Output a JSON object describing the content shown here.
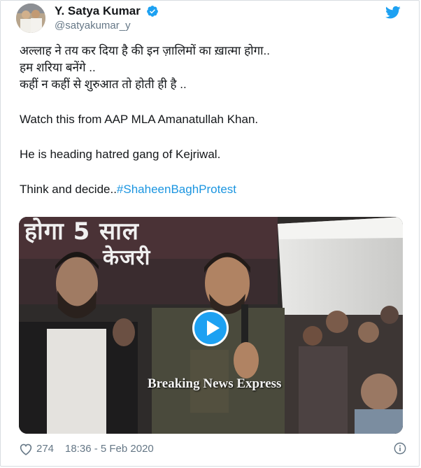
{
  "tweet": {
    "display_name": "Y. Satya Kumar",
    "handle": "@satyakumar_y",
    "verified": true,
    "text_lines": [
      "अल्लाह ने तय कर दिया है की इन ज़ालिमों का ख़ात्मा होगा..",
      "हम शरिया बनेंगे ..",
      "कहीं न कहीं से शुरुआत तो होती ही है .."
    ],
    "line_watch": "Watch this from AAP MLA Amanatullah Khan.",
    "line_heading": "He is heading hatred gang of Kejriwal.",
    "line_think_prefix": "Think and decide..",
    "hashtag": "#ShaheenBaghProtest",
    "media": {
      "watermark": "Breaking News Express",
      "banner_text_top": "होगा 5 साल",
      "banner_text_mid": "केजरी"
    },
    "likes": "274",
    "timestamp": "18:36 - 5 Feb 2020"
  },
  "icons": {
    "verified": "verified-badge-icon",
    "bird": "twitter-bird-icon",
    "heart": "heart-icon",
    "info": "info-icon",
    "play": "play-icon"
  },
  "colors": {
    "accent": "#1da1f2",
    "link": "#1b95e0",
    "muted": "#657786"
  }
}
